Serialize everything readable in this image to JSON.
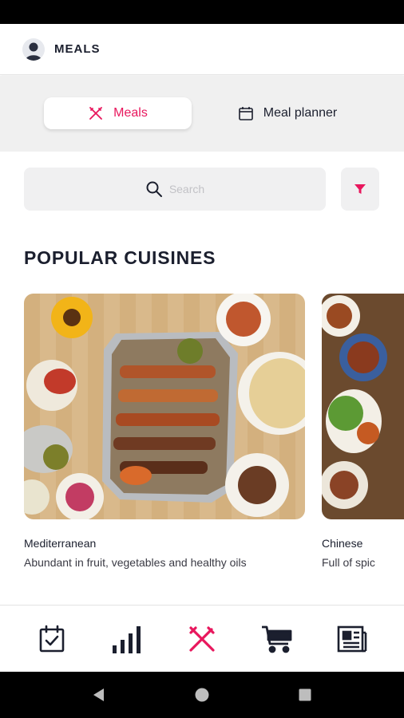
{
  "header": {
    "title": "MEALS"
  },
  "tabs": [
    {
      "label": "Meals",
      "active": true,
      "icon": "fork-knife-icon"
    },
    {
      "label": "Meal planner",
      "active": false,
      "icon": "calendar-icon"
    }
  ],
  "search": {
    "placeholder": "Search"
  },
  "section": {
    "title": "POPULAR CUISINES"
  },
  "cuisines": [
    {
      "name": "Mediterranean",
      "description": "Abundant in fruit, vegetables and healthy oils"
    },
    {
      "name": "Chinese",
      "description": "Full of spic"
    }
  ],
  "bottom_nav": [
    {
      "icon": "calendar-check-icon",
      "active": false
    },
    {
      "icon": "bar-chart-icon",
      "active": false
    },
    {
      "icon": "fork-knife-icon",
      "active": true
    },
    {
      "icon": "cart-icon",
      "active": false
    },
    {
      "icon": "newspaper-icon",
      "active": false
    }
  ],
  "colors": {
    "accent": "#e8175d",
    "dark": "#1b1f2e",
    "light_bg": "#f0f0f0"
  }
}
